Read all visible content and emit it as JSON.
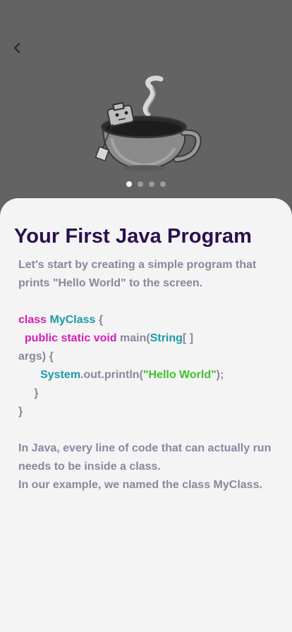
{
  "lesson": {
    "title": "Your First Java Program",
    "intro": "Let's start by creating a simple program that prints \"Hello World\" to the screen.",
    "code": {
      "line1": {
        "kw": "class",
        "type": "MyClass",
        "rest": " {"
      },
      "line2": {
        "indent": "  ",
        "kw": "public static void",
        "mid": " main(",
        "type": "String",
        "rest": "[ ]"
      },
      "line3": {
        "rest": "args) {"
      },
      "line4": {
        "indent": "       ",
        "type": "System",
        "mid": ".out.println(",
        "str": "\"Hello World\"",
        "rest": ");"
      },
      "line5": {
        "indent": "     ",
        "rest": "}"
      },
      "line6": {
        "rest": "}"
      }
    },
    "outro_1": "In Java, every line of code that can actually run needs to be inside a class.",
    "outro_2": "In our example, we named the class MyClass."
  },
  "carousel": {
    "count": 4,
    "active_index": 0
  },
  "icons": {
    "back": "chevron-left-icon",
    "hero": "java-coffee-cup-illustration"
  },
  "colors": {
    "header_bg": "#636363",
    "card_bg": "#f4f4f4",
    "title": "#2b0f4f",
    "body_text": "#8c86a0",
    "keyword": "#d81db8",
    "type": "#1a9aa8",
    "string": "#3ec12a"
  }
}
